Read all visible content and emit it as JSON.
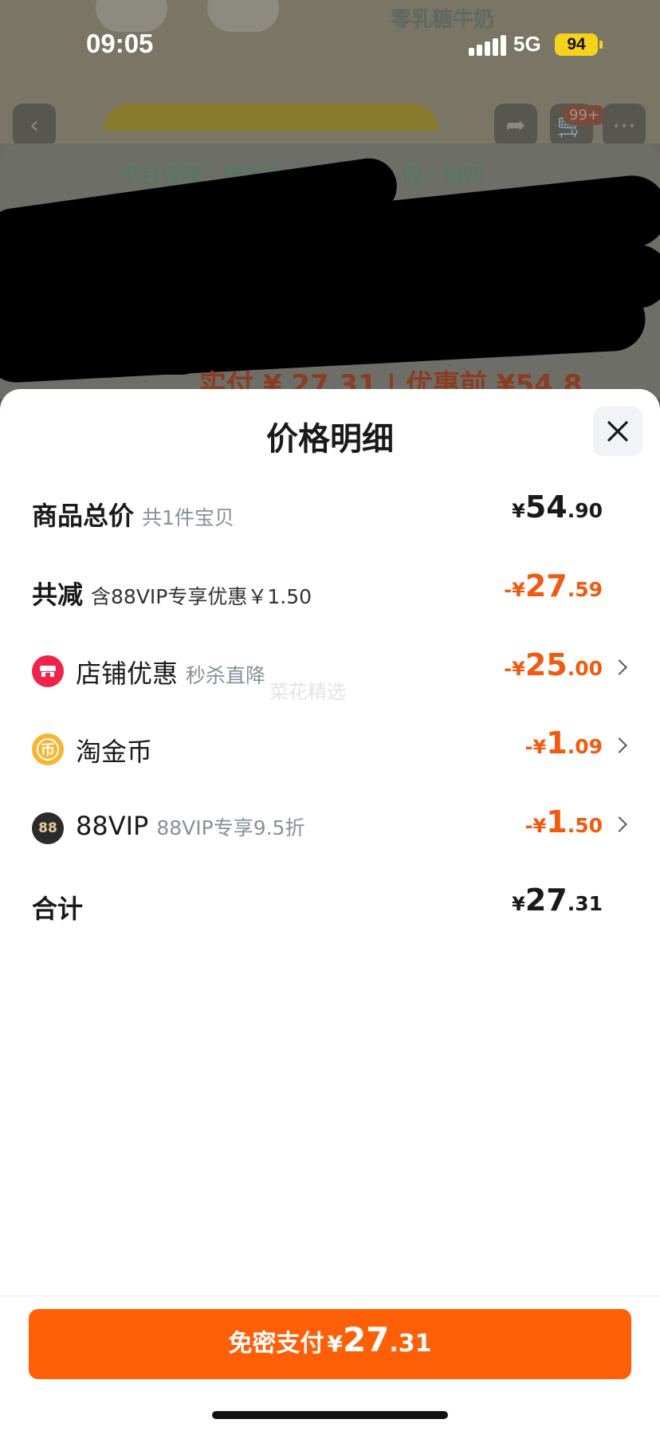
{
  "status_bar": {
    "time": "09:05",
    "network": "5G",
    "battery": "94"
  },
  "background": {
    "promo_text": "零乳糖牛奶",
    "cart_badge": "99+",
    "guarantee": "平台保障 | 破损包退·极速退款·假一赔四",
    "price_strip": "实付 ¥ 27.31 | 优惠前 ¥54.8"
  },
  "sheet": {
    "title": "价格明细",
    "watermark": "菜花精选",
    "rows": [
      {
        "label": "商品总价",
        "sub": "共1件宝贝",
        "amount": {
          "sign": "¥",
          "int": "54",
          "dec": ".90"
        }
      },
      {
        "label": "共减",
        "sub": "含88VIP专享优惠￥1.50",
        "amount": {
          "sign": "-¥",
          "int": "27",
          "dec": ".59"
        }
      },
      {
        "label": "店铺优惠",
        "sub": "秒杀直降",
        "icon": "shop-icon",
        "amount": {
          "sign": "-¥",
          "int": "25",
          "dec": ".00"
        }
      },
      {
        "label": "淘金币",
        "sub": "",
        "icon": "coin-icon",
        "icon_text": "币",
        "amount": {
          "sign": "-¥",
          "int": "1",
          "dec": ".09"
        }
      },
      {
        "label": "88VIP",
        "sub": "88VIP专享9.5折",
        "icon": "vip-icon",
        "icon_text": "88",
        "amount": {
          "sign": "-¥",
          "int": "1",
          "dec": ".50"
        }
      },
      {
        "label": "合计",
        "sub": "",
        "amount": {
          "sign": "¥",
          "int": "27",
          "dec": ".31"
        }
      }
    ]
  },
  "pay_button": {
    "label": "免密支付",
    "sign": "¥",
    "int": "27",
    "dec": ".31"
  },
  "colors": {
    "accent_orange": "#ff5f06",
    "discount_text": "#f15a10",
    "shop_icon_bg": "#f0234a",
    "coin_icon_bg": "#f7b531",
    "vip_icon_bg": "#2b2b2b"
  }
}
